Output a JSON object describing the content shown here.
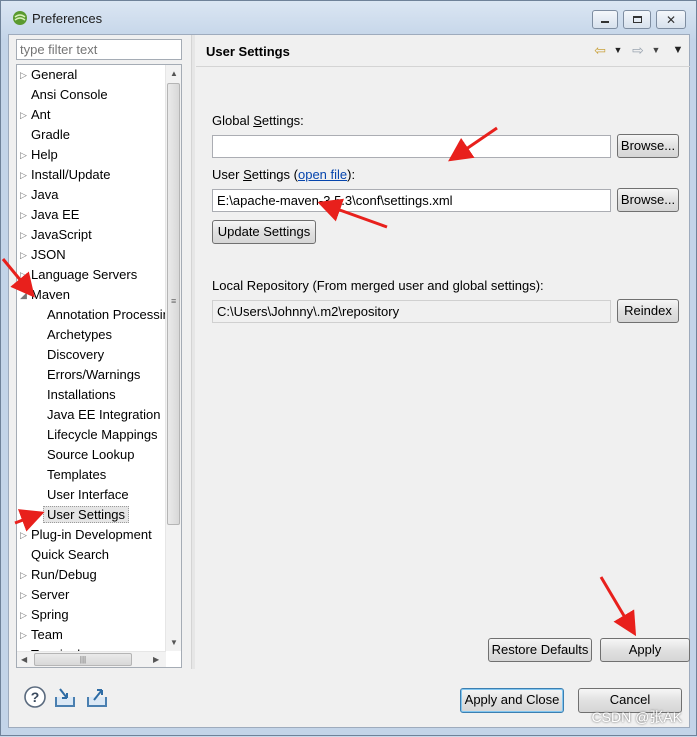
{
  "window": {
    "title": "Preferences"
  },
  "filter": {
    "placeholder": "type filter text"
  },
  "tree": {
    "items": [
      {
        "label": "General",
        "level": 0,
        "expander": "collapsed"
      },
      {
        "label": "Ansi Console",
        "level": 0,
        "expander": "none"
      },
      {
        "label": "Ant",
        "level": 0,
        "expander": "collapsed"
      },
      {
        "label": "Gradle",
        "level": 0,
        "expander": "none"
      },
      {
        "label": "Help",
        "level": 0,
        "expander": "collapsed"
      },
      {
        "label": "Install/Update",
        "level": 0,
        "expander": "collapsed"
      },
      {
        "label": "Java",
        "level": 0,
        "expander": "collapsed"
      },
      {
        "label": "Java EE",
        "level": 0,
        "expander": "collapsed"
      },
      {
        "label": "JavaScript",
        "level": 0,
        "expander": "collapsed"
      },
      {
        "label": "JSON",
        "level": 0,
        "expander": "collapsed"
      },
      {
        "label": "Language Servers",
        "level": 0,
        "expander": "collapsed"
      },
      {
        "label": "Maven",
        "level": 0,
        "expander": "expanded"
      },
      {
        "label": "Annotation Processing",
        "level": 1,
        "expander": "none"
      },
      {
        "label": "Archetypes",
        "level": 1,
        "expander": "none"
      },
      {
        "label": "Discovery",
        "level": 1,
        "expander": "none"
      },
      {
        "label": "Errors/Warnings",
        "level": 1,
        "expander": "none"
      },
      {
        "label": "Installations",
        "level": 1,
        "expander": "none"
      },
      {
        "label": "Java EE Integration",
        "level": 1,
        "expander": "none"
      },
      {
        "label": "Lifecycle Mappings",
        "level": 1,
        "expander": "none"
      },
      {
        "label": "Source Lookup",
        "level": 1,
        "expander": "none"
      },
      {
        "label": "Templates",
        "level": 1,
        "expander": "none"
      },
      {
        "label": "User Interface",
        "level": 1,
        "expander": "none"
      },
      {
        "label": "User Settings",
        "level": 1,
        "expander": "none",
        "selected": true
      },
      {
        "label": "Plug-in Development",
        "level": 0,
        "expander": "collapsed"
      },
      {
        "label": "Quick Search",
        "level": 0,
        "expander": "none"
      },
      {
        "label": "Run/Debug",
        "level": 0,
        "expander": "collapsed"
      },
      {
        "label": "Server",
        "level": 0,
        "expander": "collapsed"
      },
      {
        "label": "Spring",
        "level": 0,
        "expander": "collapsed"
      },
      {
        "label": "Team",
        "level": 0,
        "expander": "collapsed"
      },
      {
        "label": "Terminal",
        "level": 0,
        "expander": "collapsed"
      }
    ]
  },
  "page": {
    "title": "User Settings",
    "global_settings": {
      "label_pre": "Global ",
      "label_key": "S",
      "label_post": "ettings:",
      "value": ""
    },
    "user_settings": {
      "label_pre": "User ",
      "label_key": "S",
      "label_post": "ettings (",
      "link": "open file",
      "label_end": "):",
      "value": "E:\\apache-maven-3.5.3\\conf\\settings.xml"
    },
    "browse_label": "Browse...",
    "update_button": "Update Settings",
    "local_repo": {
      "label": "Local Repository (From merged user and global settings):",
      "value": "C:\\Users\\Johnny\\.m2\\repository"
    },
    "reindex_button": "Reindex",
    "restore_defaults": "Restore Defaults",
    "apply": "Apply"
  },
  "footer": {
    "apply_close": "Apply and Close",
    "cancel": "Cancel"
  },
  "watermark": "CSDN @张AK",
  "colors": {
    "annotation_arrow": "#e8201c",
    "selection": "#e5e5e5",
    "link": "#0645ad"
  }
}
